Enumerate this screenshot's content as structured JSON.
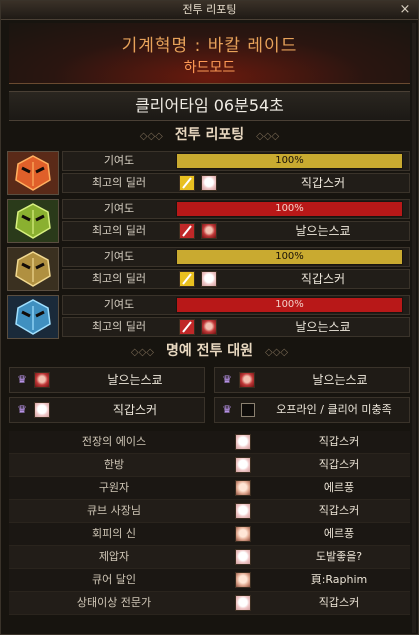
{
  "window": {
    "title": "전투 리포팅",
    "close": "×"
  },
  "raid": {
    "name": "기계혁명 : 바칼 레이드",
    "mode": "하드모드"
  },
  "clear_time": "클리어타임  06분54초",
  "battle_section": "전투 리포팅",
  "labels": {
    "contribution": "기여도",
    "best_dealer": "최고의 딜러"
  },
  "players": [
    {
      "bar_text": "100%",
      "bar_value": 100,
      "bar_color": "#c9aa30",
      "class_color": "#e8c020",
      "dealer": "직갑스커",
      "dealer_face": "white",
      "theme": "fire"
    },
    {
      "bar_text": "100%",
      "bar_value": 100,
      "bar_color": "#b81818",
      "class_color": "#c02828",
      "dealer": "날으는스쿄",
      "dealer_face": "red",
      "theme": "poison"
    },
    {
      "bar_text": "100%",
      "bar_value": 100,
      "bar_color": "#c9aa30",
      "class_color": "#e8c020",
      "dealer": "직갑스커",
      "dealer_face": "white",
      "theme": "gold"
    },
    {
      "bar_text": "100%",
      "bar_value": 100,
      "bar_color": "#b81818",
      "class_color": "#c02828",
      "dealer": "날으는스쿄",
      "dealer_face": "red",
      "theme": "ice"
    }
  ],
  "honor_section": "명예 전투 대원",
  "honor": [
    {
      "name": "날으는스쿄",
      "face": "red"
    },
    {
      "name": "날으는스쿄",
      "face": "red"
    },
    {
      "name": "직갑스커",
      "face": "white"
    },
    {
      "name": "오프라인 / 클리어 미충족",
      "face": "none"
    }
  ],
  "awards": [
    {
      "title": "전장의 에이스",
      "player": "직갑스커",
      "face": "white"
    },
    {
      "title": "한방",
      "player": "직갑스커",
      "face": "white"
    },
    {
      "title": "구원자",
      "player": "에르풍",
      "face": "tan"
    },
    {
      "title": "큐브 사장님",
      "player": "직갑스커",
      "face": "white"
    },
    {
      "title": "회피의 신",
      "player": "에르풍",
      "face": "tan"
    },
    {
      "title": "제압자",
      "player": "도발좋을?",
      "face": "white"
    },
    {
      "title": "큐어 달인",
      "player": "頁:Raphim",
      "face": "tan"
    },
    {
      "title": "상태이상 전문가",
      "player": "직갑스커",
      "face": "white"
    }
  ]
}
